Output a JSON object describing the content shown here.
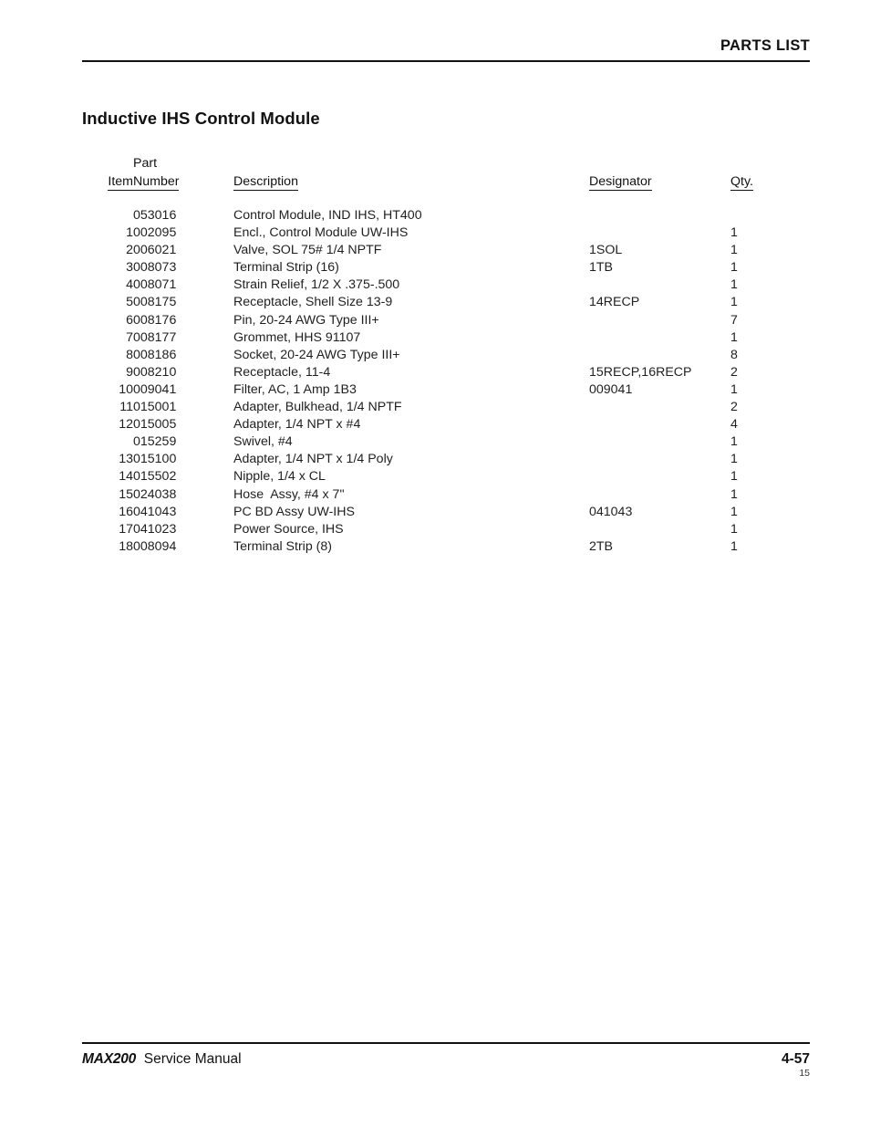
{
  "header": {
    "running_title": "PARTS LIST"
  },
  "section": {
    "title": "Inductive IHS Control Module"
  },
  "table": {
    "columns": {
      "item": "Item",
      "part_number_line1": "Part",
      "part_number_line2": "Number",
      "description": "Description",
      "designator": "Designator",
      "qty": "Qty."
    },
    "rows": [
      {
        "item": "",
        "part": "053016",
        "desc": "Control Module, IND IHS, HT400",
        "indent": 0,
        "bold": true,
        "designator": "",
        "qty": ""
      },
      {
        "item": "1",
        "part": "002095",
        "desc": "Encl., Control Module UW-IHS",
        "indent": 1,
        "bold": false,
        "designator": "",
        "qty": "1"
      },
      {
        "item": "2",
        "part": "006021",
        "desc": "Valve, SOL 75# 1/4 NPTF",
        "indent": 1,
        "bold": false,
        "designator": "1SOL",
        "qty": "1"
      },
      {
        "item": "3",
        "part": "008073",
        "desc": "Terminal Strip (16)",
        "indent": 1,
        "bold": false,
        "designator": "1TB",
        "qty": "1"
      },
      {
        "item": "4",
        "part": "008071",
        "desc": "Strain Relief, 1/2 X .375-.500",
        "indent": 1,
        "bold": false,
        "designator": "",
        "qty": "1"
      },
      {
        "item": "5",
        "part": "008175",
        "desc": "Receptacle, Shell Size 13-9",
        "indent": 1,
        "bold": false,
        "designator": "14RECP",
        "qty": "1"
      },
      {
        "item": "6",
        "part": "008176",
        "desc": "Pin, 20-24 AWG Type III+",
        "indent": 1,
        "bold": false,
        "designator": "",
        "qty": "7"
      },
      {
        "item": "7",
        "part": "008177",
        "desc": "Grommet, HHS 91107",
        "indent": 1,
        "bold": false,
        "designator": "",
        "qty": "1"
      },
      {
        "item": "8",
        "part": "008186",
        "desc": "Socket, 20-24 AWG Type III+",
        "indent": 1,
        "bold": false,
        "designator": "",
        "qty": "8"
      },
      {
        "item": "9",
        "part": "008210",
        "desc": "Receptacle, 11-4",
        "indent": 1,
        "bold": false,
        "designator": "15RECP,16RECP",
        "qty": "2"
      },
      {
        "item": "10",
        "part": "009041",
        "desc": "Filter, AC, 1 Amp 1B3",
        "indent": 1,
        "bold": false,
        "designator": "009041",
        "qty": "1"
      },
      {
        "item": "11",
        "part": "015001",
        "desc": "Adapter, Bulkhead, 1/4 NPTF",
        "indent": 1,
        "bold": false,
        "designator": "",
        "qty": "2"
      },
      {
        "item": "12",
        "part": "015005",
        "desc": "Adapter, 1/4 NPT x #4",
        "indent": 1,
        "bold": false,
        "designator": "",
        "qty": "4"
      },
      {
        "item": "",
        "part": "015259",
        "desc": "Swivel, #4",
        "indent": 1,
        "bold": false,
        "designator": "",
        "qty": "1"
      },
      {
        "item": "13",
        "part": "015100",
        "desc": "Adapter, 1/4 NPT x 1/4 Poly",
        "indent": 1,
        "bold": false,
        "designator": "",
        "qty": "1"
      },
      {
        "item": "14",
        "part": "015502",
        "desc": "Nipple, 1/4 x CL",
        "indent": 1,
        "bold": false,
        "designator": "",
        "qty": "1"
      },
      {
        "item": "15",
        "part": "024038",
        "desc": "Hose  Assy, #4 x 7\"",
        "indent": 1,
        "bold": true,
        "designator": "",
        "qty": "1"
      },
      {
        "item": "16",
        "part": "041043",
        "desc": "PC BD Assy UW-IHS",
        "indent": 1,
        "bold": true,
        "designator": "041043",
        "qty": "1"
      },
      {
        "item": "17",
        "part": "041023",
        "desc": "Power Source, IHS",
        "indent": 2,
        "bold": false,
        "designator": "",
        "qty": "1"
      },
      {
        "item": "18",
        "part": "008094",
        "desc": "Terminal Strip (8)",
        "indent": 2,
        "bold": false,
        "designator": "2TB",
        "qty": "1"
      }
    ]
  },
  "footer": {
    "brand": "MAX200",
    "manual_label": "Service Manual",
    "page_number": "4-57",
    "sheet_number": "15"
  }
}
